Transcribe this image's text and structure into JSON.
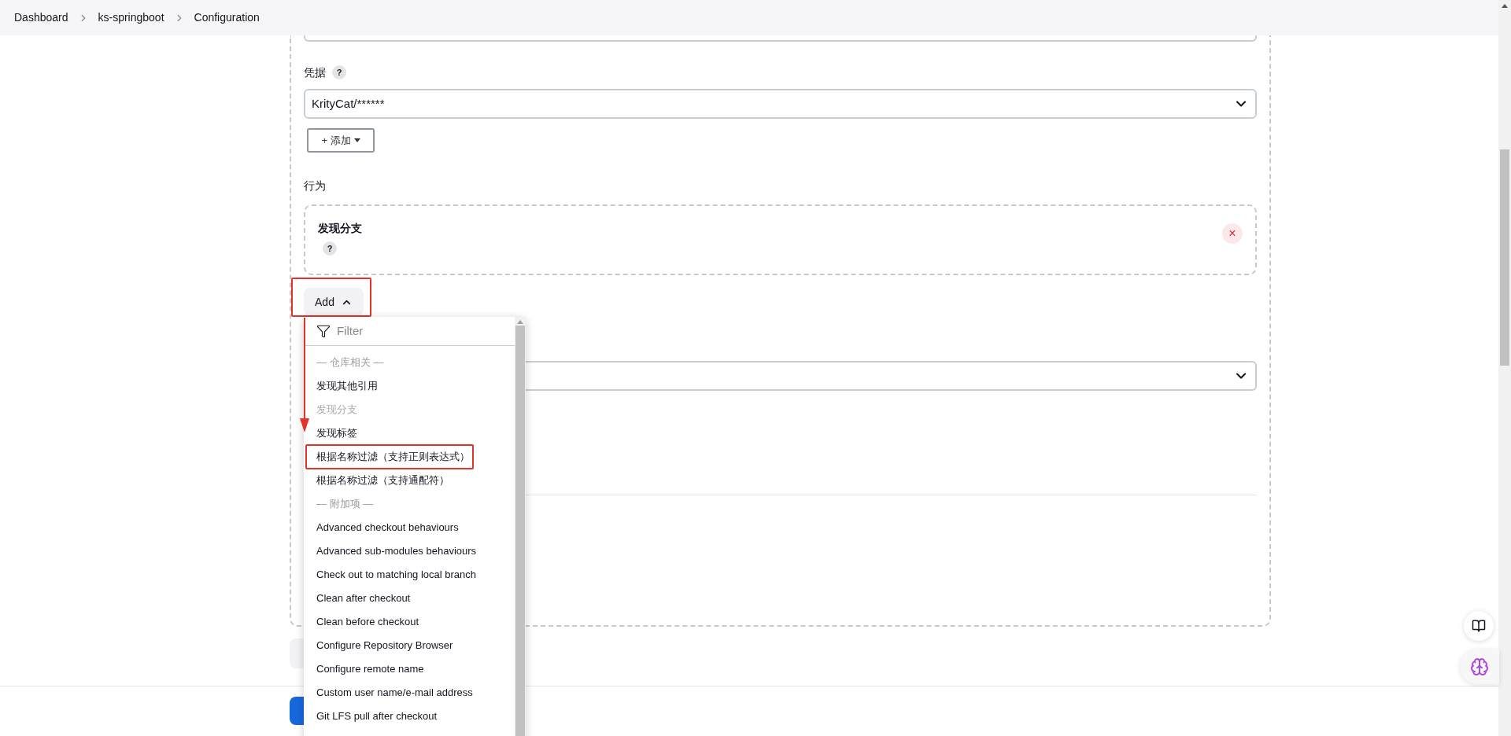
{
  "breadcrumb": [
    "Dashboard",
    "ks-springboot",
    "Configuration"
  ],
  "credentials": {
    "label": "凭据",
    "help": "?",
    "value": "KrityCat/******",
    "add_button": "+ 添加"
  },
  "behaviours": {
    "label": "行为",
    "items": [
      {
        "title": "发现分支",
        "help": "?",
        "remove": "×"
      }
    ]
  },
  "add_button": {
    "label": "Add",
    "expanded": true,
    "annotated": true
  },
  "menu": {
    "filter_placeholder": "Filter",
    "items": [
      {
        "kind": "heading",
        "label": "— 仓库相关 —"
      },
      {
        "kind": "item",
        "label": "发现其他引用",
        "disabled": false,
        "annotated": false
      },
      {
        "kind": "item",
        "label": "发现分支",
        "disabled": true,
        "annotated": false
      },
      {
        "kind": "item",
        "label": "发现标签",
        "disabled": false,
        "annotated": false
      },
      {
        "kind": "item",
        "label": "根据名称过滤（支持正则表达式）",
        "disabled": false,
        "annotated": true
      },
      {
        "kind": "item",
        "label": "根据名称过滤（支持通配符）",
        "disabled": false,
        "annotated": false
      },
      {
        "kind": "heading",
        "label": "— 附加项 —"
      },
      {
        "kind": "item",
        "label": "Advanced checkout behaviours",
        "disabled": false,
        "annotated": false
      },
      {
        "kind": "item",
        "label": "Advanced sub-modules behaviours",
        "disabled": false,
        "annotated": false
      },
      {
        "kind": "item",
        "label": "Check out to matching local branch",
        "disabled": false,
        "annotated": false
      },
      {
        "kind": "item",
        "label": "Clean after checkout",
        "disabled": false,
        "annotated": false
      },
      {
        "kind": "item",
        "label": "Clean before checkout",
        "disabled": false,
        "annotated": false
      },
      {
        "kind": "item",
        "label": "Configure Repository Browser",
        "disabled": false,
        "annotated": false
      },
      {
        "kind": "item",
        "label": "Configure remote name",
        "disabled": false,
        "annotated": false
      },
      {
        "kind": "item",
        "label": "Custom user name/e-mail address",
        "disabled": false,
        "annotated": false
      },
      {
        "kind": "item",
        "label": "Git LFS pull after checkout",
        "disabled": false,
        "annotated": false
      }
    ]
  }
}
